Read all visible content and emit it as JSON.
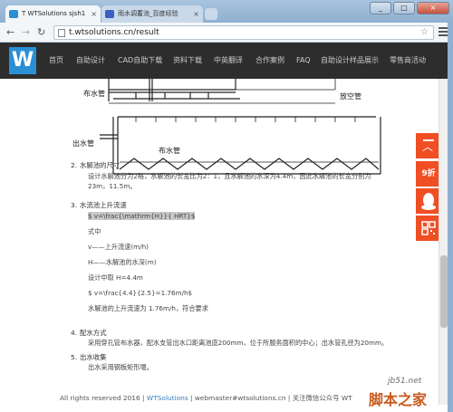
{
  "browser": {
    "tabs": [
      {
        "title": "T WTSolutions sjsh1",
        "active": true
      },
      {
        "title": "雨水调蓄池_百度经验",
        "active": false
      }
    ],
    "url": "t.wtsolutions.cn/result"
  },
  "site": {
    "logo": "W",
    "nav": [
      "首页",
      "自助设计",
      "CAD自助下载",
      "资料下载",
      "中英翻译",
      "合作案例",
      "FAQ",
      "自助设计样品展示",
      "零售商活动"
    ]
  },
  "diagram": {
    "labels": {
      "inflow_top": "布水管",
      "vent": "放空管",
      "outflow": "出水管",
      "inflow_bottom": "布水管"
    }
  },
  "content": {
    "sections": [
      {
        "num": "2.",
        "title": "水解池的尺寸",
        "lines": [
          "设计水解池分为2格，水解池的长宽比为2：1，且水解池的水深为4.4m，因此水解池的长宽分别为",
          "23m，11.5m。"
        ]
      },
      {
        "num": "3.",
        "title": "水流池上升流速",
        "formula": "$ v=\\frac{\\mathrm{H}}{ HRT}$",
        "lines": [
          "式中",
          "v——上升流速(m/h)",
          "H——水解池的水深(m)",
          "设计中取 H=4.4m",
          "$ v=\\frac{4.4}{2.5}=1.76m/h$",
          "水解池的上升流速为 1.76m/h，符合要求"
        ]
      },
      {
        "num": "4.",
        "title": "配水方式",
        "lines": [
          "采用穿孔管布水器，配水支管出水口距离池底200mm，位于所服务面积的中心；出水管孔径为20mm。"
        ]
      },
      {
        "num": "5.",
        "title": "出水收集",
        "lines": [
          "出水采用钢板矩形堰。"
        ]
      }
    ],
    "footer": {
      "prefix": "All rights reserved 2016 |",
      "link": "WTSolutions",
      "suffix": "| webmaster#wtsolutions.cn | 关注微信公众号 WT"
    }
  },
  "widgets": {
    "discount": "9折"
  },
  "watermark": {
    "site": "jb51.net",
    "name": "脚本之家"
  }
}
